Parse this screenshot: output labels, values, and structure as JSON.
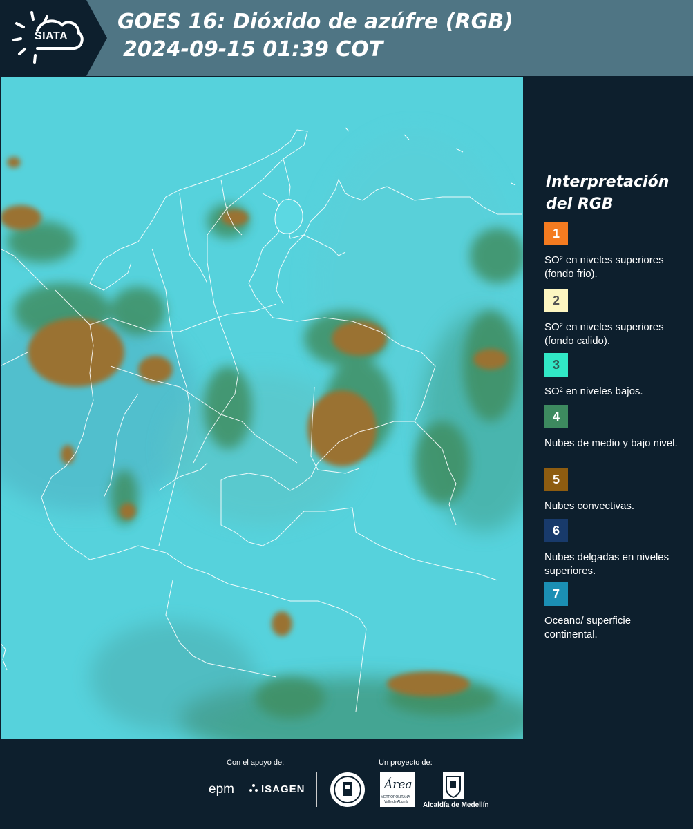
{
  "header": {
    "logo_text": "SIATA",
    "title_line1": "GOES 16: Dióxido de azúfre (RGB)",
    "title_line2": "2024-09-15 01:39 COT"
  },
  "legend": {
    "title_line1": "Interpretación",
    "title_line2": "del RGB",
    "items": [
      {
        "number": "1",
        "color": "#f47b20",
        "label": "SO² en niveles superiores (fondo frio)."
      },
      {
        "number": "2",
        "color": "#fdf6c1",
        "label": "SO² en niveles superiores (fondo calido)."
      },
      {
        "number": "3",
        "color": "#31e8c6",
        "label": "SO² en niveles bajos."
      },
      {
        "number": "4",
        "color": "#3d8a5f",
        "label": "Nubes de medio y bajo nivel."
      },
      {
        "number": "5",
        "color": "#8d5c10",
        "label": "Nubes convectivas."
      },
      {
        "number": "6",
        "color": "#183a6b",
        "label": "Nubes delgadas en niveles superiores."
      },
      {
        "number": "7",
        "color": "#1b8fb4",
        "label": "Oceano/ superficie continental."
      }
    ]
  },
  "footer": {
    "support_label": "Con el apoyo de:",
    "project_label": "Un proyecto de:",
    "sponsor1": "epm",
    "sponsor2": "ISAGEN",
    "partner1_line1": "Área",
    "partner1_line2": "METROPOLITANA",
    "partner1_line3": "Valle de Aburrá",
    "partner2": "Alcaldía de Medellín"
  }
}
